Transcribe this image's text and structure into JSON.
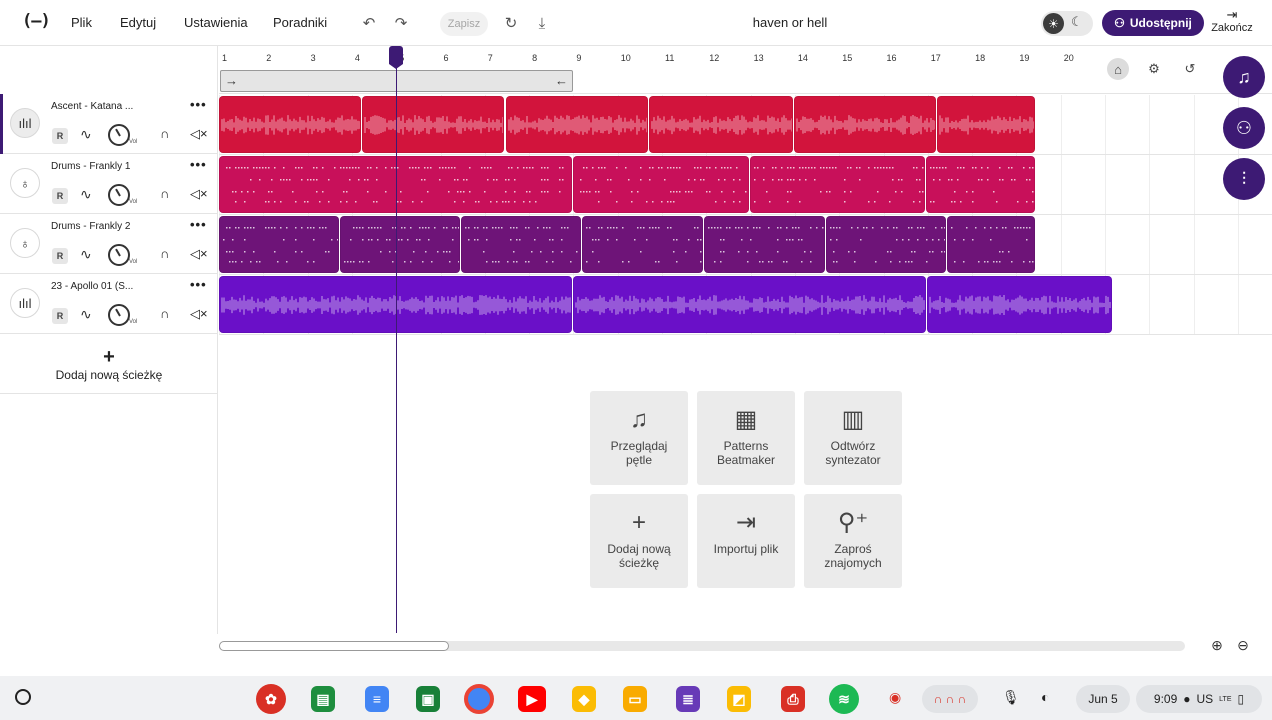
{
  "topbar": {
    "logo": "(—)",
    "menu": [
      "Plik",
      "Edytuj",
      "Ustawienia",
      "Poradniki"
    ],
    "save_label": "Zapisz",
    "project_title": "haven or hell",
    "share_label": "Udostępnij",
    "exit_label": "Zakończ"
  },
  "ruler": {
    "bars": [
      "1",
      "2",
      "3",
      "4",
      "5",
      "6",
      "7",
      "8",
      "9",
      "10",
      "11",
      "12",
      "13",
      "14",
      "15",
      "16",
      "17",
      "18",
      "19",
      "20"
    ]
  },
  "tracks": [
    {
      "name": "Ascent - Katana ...",
      "rec": "R",
      "vol": "Vol",
      "color": "#d2143c",
      "icon": "waveform-icon"
    },
    {
      "name": "Drums - Frankly 1",
      "rec": "R",
      "vol": "Vol",
      "color": "#c8105a",
      "icon": "drum-icon"
    },
    {
      "name": "Drums - Frankly 2",
      "rec": "R",
      "vol": "Vol",
      "color": "#6e1478",
      "icon": "drum-icon"
    },
    {
      "name": "23 - Apollo 01 (S...",
      "rec": "R",
      "vol": "Vol",
      "color": "#6a10c8",
      "icon": "waveform-icon"
    }
  ],
  "add_track": {
    "label": "Dodaj nową ścieżkę"
  },
  "actions": [
    {
      "label": "Przeglądaj pętle",
      "icon": "music-note-icon"
    },
    {
      "label": "Patterns Beatmaker",
      "icon": "pattern-grid-icon"
    },
    {
      "label": "Odtwórz syntezator",
      "icon": "piano-keys-icon"
    },
    {
      "label": "Dodaj nową ścieżkę",
      "icon": "plus-icon"
    },
    {
      "label": "Importuj plik",
      "icon": "import-icon"
    },
    {
      "label": "Zaproś znajomych",
      "icon": "invite-user-icon"
    }
  ],
  "shelf": {
    "date": "Jun 5",
    "time": "9:09",
    "locale": "US",
    "network": "LTE"
  },
  "colors": {
    "accent": "#3d1a74",
    "clip_red": "#d2143c",
    "clip_pink": "#c8105a",
    "clip_plum": "#6e1478",
    "clip_purple": "#6a10c8"
  }
}
